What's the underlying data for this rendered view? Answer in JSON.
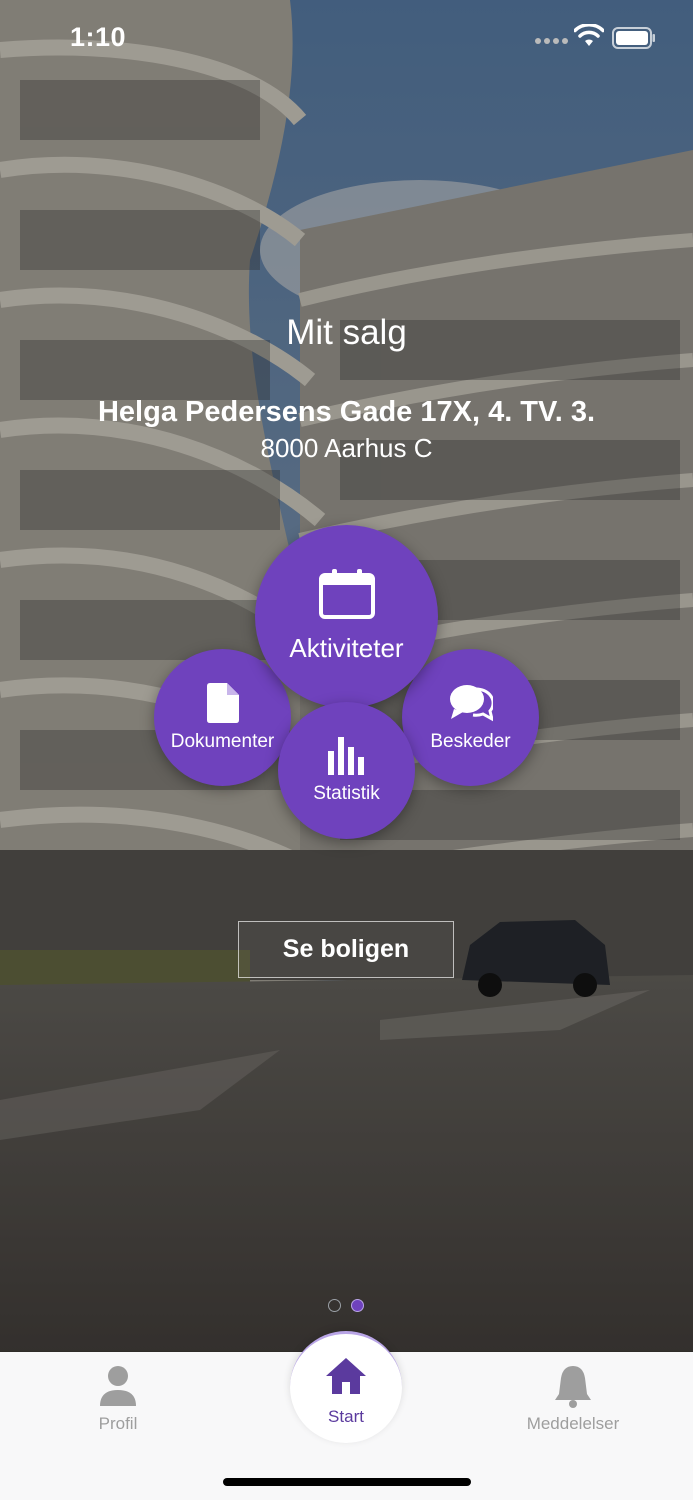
{
  "status_bar": {
    "time": "1:10"
  },
  "header": {
    "title": "Mit salg",
    "address": "Helga Pedersens Gade 17X, 4. TV. 3.",
    "city": "8000 Aarhus C"
  },
  "actions": {
    "aktiviteter": {
      "label": "Aktiviteter",
      "icon": "calendar-icon"
    },
    "dokumenter": {
      "label": "Dokumenter",
      "icon": "document-icon"
    },
    "statistik": {
      "label": "Statistik",
      "icon": "bar-chart-icon"
    },
    "beskeder": {
      "label": "Beskeder",
      "icon": "chat-bubbles-icon"
    }
  },
  "cta": {
    "label": "Se boligen"
  },
  "pager": {
    "page_count": 2,
    "active_page": 2
  },
  "tab_bar": {
    "profil": {
      "label": "Profil",
      "icon": "person-icon"
    },
    "start": {
      "label": "Start",
      "icon": "home-icon"
    },
    "meddelelser": {
      "label": "Meddelelser",
      "icon": "bell-icon"
    }
  },
  "colors": {
    "accent": "#6f42bd",
    "tab_inactive": "#9e9e9e",
    "tab_active": "#5b3a9e"
  }
}
